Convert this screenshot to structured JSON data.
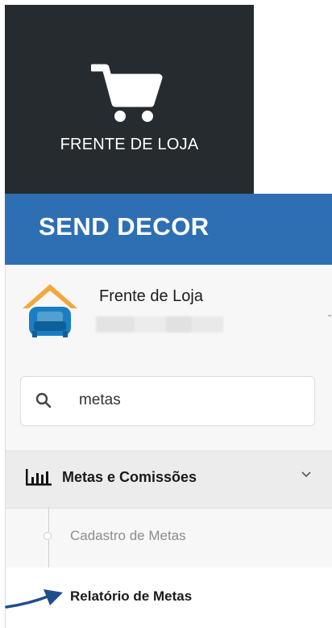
{
  "tile": {
    "label": "FRENTE DE LOJA",
    "icon": "shopping-cart-icon"
  },
  "header": {
    "brand": "SEND DECOR",
    "color": "#2e6fb4"
  },
  "profile": {
    "name": "Frente de Loja",
    "icon": "house-armchair-logo"
  },
  "search": {
    "value": "metas",
    "icon": "search-icon"
  },
  "menu": {
    "group_label": "Metas e Comissões",
    "group_icon": "bar-chart-icon",
    "items": [
      {
        "label": "Cadastro de Metas"
      },
      {
        "label": "Relatório de Metas"
      }
    ]
  },
  "colors": {
    "tile_bg": "#262b2f",
    "arrow": "#1f4e8c"
  }
}
